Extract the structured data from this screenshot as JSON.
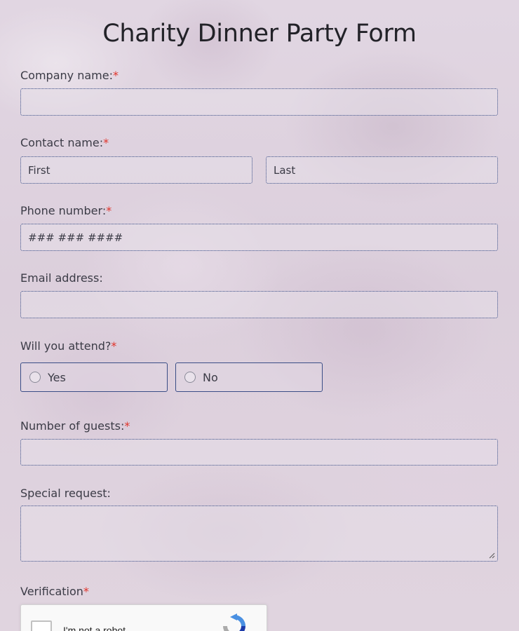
{
  "title": "Charity Dinner Party Form",
  "required_mark": "*",
  "colors": {
    "required": "#e0342a",
    "border": "#3a4d86",
    "text": "#3b3b46"
  },
  "fields": {
    "company": {
      "label": "Company name:",
      "value": "",
      "placeholder": ""
    },
    "contact": {
      "label": "Contact name:",
      "first_placeholder": "First",
      "last_placeholder": "Last"
    },
    "phone": {
      "label": "Phone number:",
      "placeholder": "### ### ####"
    },
    "email": {
      "label": "Email address:",
      "placeholder": ""
    },
    "attend": {
      "label": "Will you attend?",
      "options": [
        {
          "label": "Yes",
          "selected": false
        },
        {
          "label": "No",
          "selected": false
        }
      ]
    },
    "guests": {
      "label": "Number of guests:",
      "placeholder": ""
    },
    "special": {
      "label": "Special request:",
      "placeholder": ""
    },
    "verification": {
      "label": "Verification",
      "captcha_text": "I'm not a robot",
      "captcha_icon": "recaptcha-icon"
    }
  }
}
